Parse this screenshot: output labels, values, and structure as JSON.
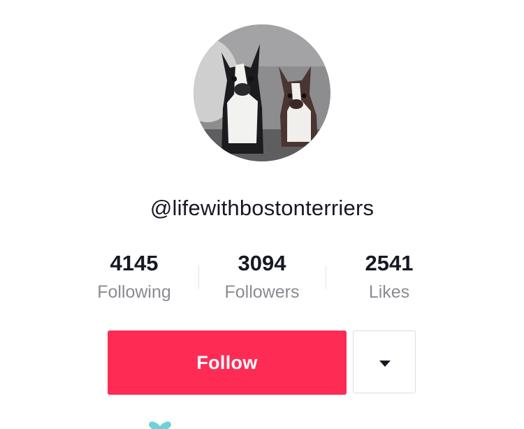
{
  "profile": {
    "username": "@lifewithbostonterriers",
    "avatar_alt": "profile-avatar-two-boston-terriers"
  },
  "stats": [
    {
      "count": "4145",
      "label": "Following"
    },
    {
      "count": "3094",
      "label": "Followers"
    },
    {
      "count": "2541",
      "label": "Likes"
    }
  ],
  "actions": {
    "follow_label": "Follow",
    "more_icon": "caret-down-icon"
  },
  "colors": {
    "follow_button": "#fe2c55",
    "text_primary": "#161823",
    "text_secondary": "#8a8b91",
    "partial_icon": "#6fd2d8"
  }
}
